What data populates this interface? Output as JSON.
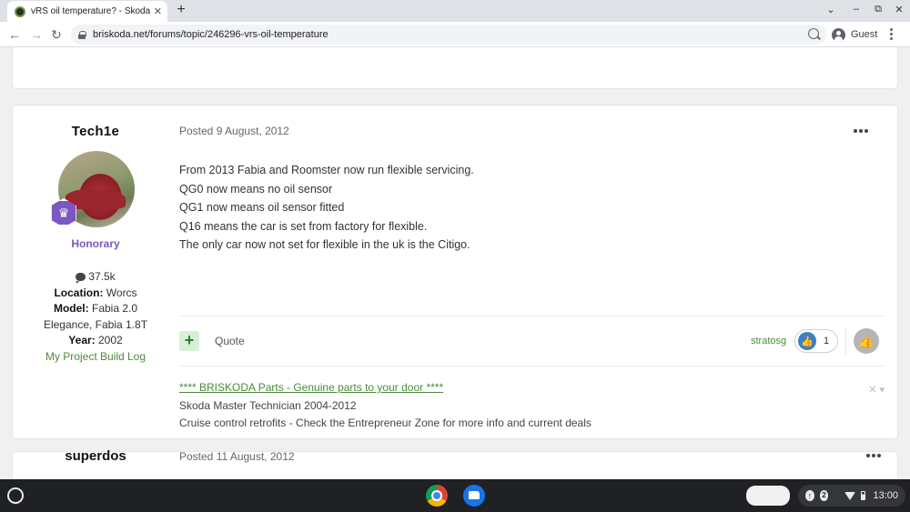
{
  "browser": {
    "tab_title": "vRS oil temperature? - Skoda Fa",
    "tab_close": "✕",
    "new_tab": "+",
    "url": "briskoda.net/forums/topic/246296-vrs-oil-temperature",
    "profile_label": "Guest",
    "win_minimize": "–",
    "win_restore": "⧉",
    "win_close": "✕",
    "win_tabsearch": "⌄"
  },
  "post": {
    "author": "Tech1e",
    "rank": "Honorary",
    "post_count": "37.5k",
    "location_label": "Location:",
    "location": "Worcs",
    "model_label": "Model:",
    "model": "Fabia 2.0",
    "model_line2": "Elegance, Fabia 1.8T",
    "year_label": "Year:",
    "year": "2002",
    "project_link": "My Project Build Log",
    "date": "Posted 9 August, 2012",
    "body": [
      "From 2013 Fabia and Roomster now run flexible servicing.",
      "QG0 now means no oil sensor",
      "QG1 now means oil sensor fitted",
      "Q16 means the car is set from factory for flexible.",
      "The only car now not set for flexible in the uk is the Citigo."
    ],
    "plus": "+",
    "quote_label": "Quote",
    "liker": "stratosg",
    "reaction_count": "1",
    "signature": {
      "link": "**** BRISKODA Parts - Genuine parts to your door ****",
      "line1": "Skoda Master Technician 2004-2012",
      "line2": "Cruise control retrofits - Check the Entrepreneur Zone for more info and current deals"
    }
  },
  "next_post": {
    "author": "superdos",
    "date": "Posted 11 August, 2012"
  },
  "shelf": {
    "notification_count": "2",
    "clock": "13:00"
  },
  "colors": {
    "accent_green": "#4a8b3b",
    "rank_purple": "#7b57c2",
    "like_blue": "#3b7fc4"
  }
}
